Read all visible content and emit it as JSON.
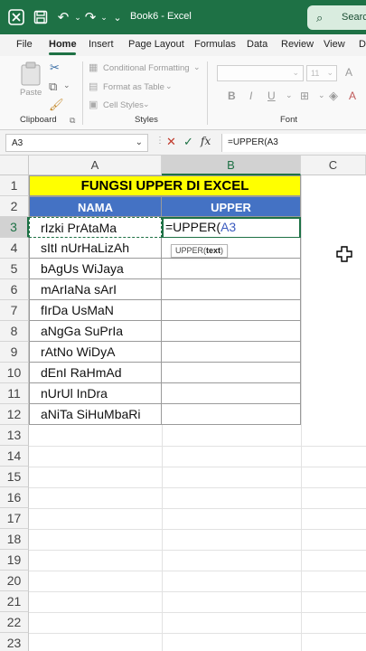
{
  "titlebar": {
    "title": "Book6  -  Excel",
    "search_label": "Searc"
  },
  "menu": {
    "items": [
      "File",
      "Home",
      "Insert",
      "Page Layout",
      "Formulas",
      "Data",
      "Review",
      "View",
      "Dev"
    ],
    "active": "Home"
  },
  "ribbon": {
    "clipboard": {
      "paste_label": "Paste",
      "group_label": "Clipboard"
    },
    "styles": {
      "conditional_formatting": "Conditional Formatting",
      "format_as_table": "Format as Table",
      "cell_styles": "Cell Styles",
      "group_label": "Styles"
    },
    "font": {
      "size": "11",
      "group_label": "Font"
    }
  },
  "formula_bar": {
    "name_box": "A3",
    "formula": "=UPPER(A3"
  },
  "grid": {
    "columns": [
      "A",
      "B",
      "C"
    ],
    "rows": [
      "1",
      "2",
      "3",
      "4",
      "5",
      "6",
      "7",
      "8",
      "9",
      "10",
      "11",
      "12",
      "13",
      "14",
      "15",
      "16",
      "17",
      "18",
      "19",
      "20",
      "21",
      "22",
      "23"
    ],
    "title": "FUNGSI UPPER DI EXCEL",
    "header_nama": "NAMA",
    "header_upper": "UPPER",
    "names": [
      "rIzki PrAtaMa",
      "sItI nUrHaLizAh",
      "bAgUs WiJaya",
      "mArIaNa sArI",
      "fIrDa UsMaN",
      "aNgGa SuPrIa",
      "rAtNo WiDyA",
      "dEnI RaHmAd",
      "nUrUl InDra",
      "aNiTa SiHuMbaRi"
    ],
    "active_cell_editing": {
      "prefix": "=UPPER(",
      "ref": "A3"
    },
    "tooltip": {
      "fn": "UPPER(",
      "arg": "text",
      "close": ")"
    }
  },
  "colors": {
    "excel_green": "#1e7145",
    "title_fill": "#ffff00",
    "header_fill": "#4472c4"
  }
}
